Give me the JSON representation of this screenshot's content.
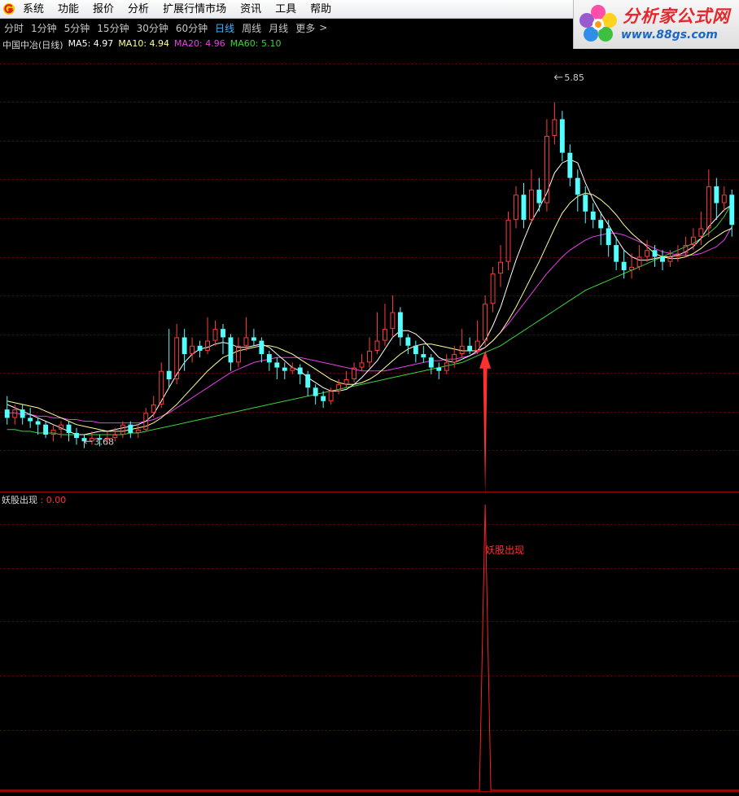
{
  "menu": {
    "items": [
      "系统",
      "功能",
      "报价",
      "分析",
      "扩展行情市场",
      "资讯",
      "工具",
      "帮助"
    ]
  },
  "brand": {
    "title": "分析家公式网",
    "url": "www.88gs.com"
  },
  "periods": {
    "tabs": [
      "分时",
      "1分钟",
      "5分钟",
      "15分钟",
      "30分钟",
      "60分钟",
      "日线",
      "周线",
      "月线",
      "更多"
    ],
    "active": "日线",
    "more_icon": "chevron-right-icon"
  },
  "legend": {
    "title": "中国中冶(日线)",
    "ma5": "MA5: 4.97",
    "ma10": "MA10: 4.94",
    "ma20": "MA20: 4.96",
    "ma60": "MA60: 5.10"
  },
  "indicator": {
    "name": "妖股出现",
    "value": ": 0.00",
    "signal_label": "妖股出现"
  },
  "colors": {
    "up": "#ff3c3c",
    "down": "#54ffff",
    "ma5": "#ffffff",
    "ma10": "#ffff9a",
    "ma20": "#e640e6",
    "ma60": "#3cd23c",
    "signal": "#ff2020",
    "background": "#000000"
  },
  "chart_data": {
    "type": "candlestick",
    "price_range": [
      3.4,
      6.0
    ],
    "high_label": "5.85",
    "low_label": "3.68",
    "high": 5.85,
    "low": 3.68,
    "candles": [
      [
        3.87,
        3.82,
        3.95,
        3.78
      ],
      [
        3.82,
        3.87,
        3.9,
        3.78
      ],
      [
        3.87,
        3.82,
        3.9,
        3.78
      ],
      [
        3.82,
        3.8,
        3.88,
        3.76
      ],
      [
        3.8,
        3.78,
        3.82,
        3.72
      ],
      [
        3.78,
        3.72,
        3.8,
        3.7
      ],
      [
        3.72,
        3.75,
        3.78,
        3.68
      ],
      [
        3.75,
        3.78,
        3.8,
        3.7
      ],
      [
        3.78,
        3.73,
        3.8,
        3.68
      ],
      [
        3.73,
        3.7,
        3.76,
        3.66
      ],
      [
        3.7,
        3.68,
        3.72,
        3.64
      ],
      [
        3.68,
        3.7,
        3.74,
        3.66
      ],
      [
        3.7,
        3.69,
        3.72,
        3.65
      ],
      [
        3.69,
        3.7,
        3.74,
        3.66
      ],
      [
        3.7,
        3.72,
        3.76,
        3.68
      ],
      [
        3.72,
        3.78,
        3.8,
        3.7
      ],
      [
        3.78,
        3.73,
        3.8,
        3.7
      ],
      [
        3.73,
        3.75,
        3.78,
        3.7
      ],
      [
        3.75,
        3.85,
        3.88,
        3.74
      ],
      [
        3.85,
        3.9,
        3.95,
        3.82
      ],
      [
        3.9,
        4.1,
        4.15,
        3.88
      ],
      [
        4.1,
        4.05,
        4.35,
        4.0
      ],
      [
        4.05,
        4.3,
        4.38,
        4.02
      ],
      [
        4.3,
        4.2,
        4.35,
        4.1
      ],
      [
        4.2,
        4.25,
        4.3,
        4.15
      ],
      [
        4.25,
        4.22,
        4.28,
        4.18
      ],
      [
        4.22,
        4.28,
        4.42,
        4.2
      ],
      [
        4.28,
        4.35,
        4.4,
        4.25
      ],
      [
        4.35,
        4.3,
        4.38,
        4.2
      ],
      [
        4.3,
        4.15,
        4.32,
        4.1
      ],
      [
        4.15,
        4.25,
        4.3,
        4.12
      ],
      [
        4.25,
        4.3,
        4.42,
        4.22
      ],
      [
        4.3,
        4.28,
        4.35,
        4.25
      ],
      [
        4.28,
        4.2,
        4.3,
        4.15
      ],
      [
        4.2,
        4.15,
        4.22,
        4.1
      ],
      [
        4.15,
        4.12,
        4.18,
        4.05
      ],
      [
        4.12,
        4.1,
        4.15,
        4.05
      ],
      [
        4.1,
        4.12,
        4.15,
        4.08
      ],
      [
        4.12,
        4.08,
        4.14,
        4.02
      ],
      [
        4.08,
        4.0,
        4.1,
        3.95
      ],
      [
        4.0,
        3.95,
        4.02,
        3.9
      ],
      [
        3.95,
        3.92,
        3.98,
        3.88
      ],
      [
        3.92,
        3.98,
        4.0,
        3.9
      ],
      [
        3.98,
        4.02,
        4.05,
        3.96
      ],
      [
        4.02,
        4.05,
        4.1,
        4.0
      ],
      [
        4.05,
        4.12,
        4.15,
        4.03
      ],
      [
        4.12,
        4.15,
        4.2,
        4.1
      ],
      [
        4.15,
        4.22,
        4.3,
        4.12
      ],
      [
        4.22,
        4.28,
        4.45,
        4.2
      ],
      [
        4.28,
        4.35,
        4.5,
        4.25
      ],
      [
        4.35,
        4.45,
        4.55,
        4.3
      ],
      [
        4.45,
        4.3,
        4.48,
        4.25
      ],
      [
        4.3,
        4.25,
        4.32,
        4.2
      ],
      [
        4.25,
        4.2,
        4.28,
        4.15
      ],
      [
        4.2,
        4.18,
        4.25,
        4.15
      ],
      [
        4.18,
        4.12,
        4.2,
        4.08
      ],
      [
        4.12,
        4.1,
        4.15,
        4.05
      ],
      [
        4.1,
        4.15,
        4.2,
        4.08
      ],
      [
        4.15,
        4.2,
        4.25,
        4.12
      ],
      [
        4.2,
        4.25,
        4.35,
        4.18
      ],
      [
        4.25,
        4.22,
        4.3,
        4.2
      ],
      [
        4.22,
        4.28,
        4.4,
        4.2
      ],
      [
        4.28,
        4.5,
        4.55,
        4.25
      ],
      [
        4.5,
        4.68,
        4.72,
        4.45
      ],
      [
        4.68,
        4.75,
        4.85,
        4.6
      ],
      [
        4.75,
        5.0,
        5.05,
        4.7
      ],
      [
        5.0,
        5.15,
        5.2,
        4.95
      ],
      [
        5.15,
        5.0,
        5.22,
        4.95
      ],
      [
        5.0,
        5.18,
        5.3,
        4.98
      ],
      [
        5.18,
        5.1,
        5.25,
        5.05
      ],
      [
        5.1,
        5.5,
        5.6,
        5.05
      ],
      [
        5.5,
        5.6,
        5.7,
        5.45
      ],
      [
        5.6,
        5.4,
        5.65,
        5.35
      ],
      [
        5.4,
        5.25,
        5.45,
        5.2
      ],
      [
        5.25,
        5.15,
        5.3,
        5.05
      ],
      [
        5.15,
        5.05,
        5.2,
        4.98
      ],
      [
        5.05,
        5.0,
        5.1,
        4.95
      ],
      [
        5.0,
        4.95,
        5.05,
        4.85
      ],
      [
        4.95,
        4.85,
        5.0,
        4.78
      ],
      [
        4.85,
        4.75,
        4.9,
        4.7
      ],
      [
        4.75,
        4.7,
        4.82,
        4.65
      ],
      [
        4.7,
        4.72,
        4.8,
        4.65
      ],
      [
        4.72,
        4.78,
        4.85,
        4.7
      ],
      [
        4.78,
        4.82,
        4.88,
        4.75
      ],
      [
        4.82,
        4.78,
        4.85,
        4.72
      ],
      [
        4.78,
        4.75,
        4.82,
        4.7
      ],
      [
        4.75,
        4.78,
        4.82,
        4.72
      ],
      [
        4.78,
        4.8,
        4.85,
        4.75
      ],
      [
        4.8,
        4.85,
        4.9,
        4.78
      ],
      [
        4.85,
        4.9,
        4.95,
        4.82
      ],
      [
        4.9,
        4.95,
        5.05,
        4.85
      ],
      [
        4.95,
        5.2,
        5.3,
        4.9
      ],
      [
        5.2,
        5.1,
        5.25,
        5.0
      ],
      [
        5.1,
        5.15,
        5.2,
        5.05
      ],
      [
        5.15,
        4.97,
        5.18,
        4.9
      ]
    ],
    "ma5": [
      3.9,
      3.88,
      3.86,
      3.84,
      3.82,
      3.8,
      3.78,
      3.76,
      3.74,
      3.72,
      3.72,
      3.73,
      3.74,
      3.74,
      3.75,
      3.76,
      3.77,
      3.78,
      3.8,
      3.84,
      3.92,
      4.0,
      4.08,
      4.15,
      4.2,
      4.23,
      4.24,
      4.26,
      4.27,
      4.26,
      4.24,
      4.24,
      4.25,
      4.26,
      4.24,
      4.2,
      4.16,
      4.12,
      4.1,
      4.06,
      4.03,
      4.0,
      3.98,
      3.98,
      3.99,
      4.02,
      4.06,
      4.11,
      4.16,
      4.23,
      4.3,
      4.34,
      4.34,
      4.32,
      4.28,
      4.23,
      4.18,
      4.16,
      4.15,
      4.17,
      4.19,
      4.22,
      4.28,
      4.37,
      4.48,
      4.62,
      4.76,
      4.88,
      4.99,
      5.07,
      5.16,
      5.28,
      5.34,
      5.36,
      5.34,
      5.22,
      5.12,
      5.04,
      4.97,
      4.89,
      4.82,
      4.78,
      4.76,
      4.76,
      4.77,
      4.78,
      4.78,
      4.79,
      4.81,
      4.84,
      4.89,
      4.96,
      5.01,
      5.06,
      5.09
    ],
    "ma10": [
      3.92,
      3.91,
      3.9,
      3.89,
      3.88,
      3.86,
      3.84,
      3.82,
      3.8,
      3.78,
      3.77,
      3.76,
      3.75,
      3.74,
      3.74,
      3.74,
      3.75,
      3.76,
      3.77,
      3.79,
      3.82,
      3.86,
      3.9,
      3.95,
      4.0,
      4.05,
      4.1,
      4.14,
      4.18,
      4.2,
      4.22,
      4.23,
      4.24,
      4.25,
      4.25,
      4.24,
      4.22,
      4.2,
      4.17,
      4.14,
      4.11,
      4.08,
      4.05,
      4.03,
      4.02,
      4.02,
      4.03,
      4.05,
      4.08,
      4.12,
      4.16,
      4.2,
      4.23,
      4.25,
      4.26,
      4.26,
      4.25,
      4.24,
      4.23,
      4.22,
      4.22,
      4.22,
      4.24,
      4.28,
      4.33,
      4.4,
      4.48,
      4.57,
      4.66,
      4.75,
      4.85,
      4.95,
      5.04,
      5.1,
      5.14,
      5.16,
      5.15,
      5.12,
      5.08,
      5.03,
      4.97,
      4.92,
      4.88,
      4.84,
      4.8,
      4.78,
      4.77,
      4.77,
      4.78,
      4.8,
      4.83,
      4.87,
      4.9,
      4.93,
      4.95
    ],
    "ma20": [
      3.85,
      3.85,
      3.84,
      3.84,
      3.83,
      3.83,
      3.82,
      3.82,
      3.81,
      3.81,
      3.8,
      3.8,
      3.79,
      3.79,
      3.79,
      3.79,
      3.79,
      3.79,
      3.8,
      3.81,
      3.83,
      3.85,
      3.88,
      3.91,
      3.94,
      3.97,
      4.0,
      4.03,
      4.06,
      4.09,
      4.11,
      4.13,
      4.15,
      4.16,
      4.17,
      4.18,
      4.18,
      4.18,
      4.18,
      4.17,
      4.16,
      4.15,
      4.14,
      4.13,
      4.12,
      4.11,
      4.1,
      4.1,
      4.1,
      4.1,
      4.11,
      4.12,
      4.13,
      4.14,
      4.15,
      4.16,
      4.16,
      4.17,
      4.17,
      4.18,
      4.19,
      4.21,
      4.24,
      4.28,
      4.33,
      4.38,
      4.44,
      4.5,
      4.56,
      4.62,
      4.68,
      4.73,
      4.78,
      4.82,
      4.85,
      4.88,
      4.9,
      4.91,
      4.92,
      4.92,
      4.91,
      4.89,
      4.87,
      4.85,
      4.83,
      4.81,
      4.8,
      4.79,
      4.79,
      4.79,
      4.8,
      4.82,
      4.84,
      4.88,
      4.96
    ],
    "ma60": [
      3.75,
      3.75,
      3.74,
      3.74,
      3.73,
      3.73,
      3.73,
      3.72,
      3.72,
      3.72,
      3.72,
      3.72,
      3.72,
      3.72,
      3.72,
      3.72,
      3.73,
      3.73,
      3.74,
      3.75,
      3.76,
      3.77,
      3.78,
      3.79,
      3.8,
      3.81,
      3.82,
      3.83,
      3.84,
      3.85,
      3.86,
      3.87,
      3.88,
      3.89,
      3.9,
      3.91,
      3.92,
      3.93,
      3.94,
      3.95,
      3.96,
      3.97,
      3.98,
      3.99,
      4.0,
      4.01,
      4.02,
      4.03,
      4.04,
      4.05,
      4.06,
      4.07,
      4.08,
      4.09,
      4.1,
      4.11,
      4.12,
      4.13,
      4.14,
      4.15,
      4.17,
      4.19,
      4.21,
      4.23,
      4.25,
      4.28,
      4.31,
      4.34,
      4.37,
      4.4,
      4.43,
      4.46,
      4.49,
      4.52,
      4.55,
      4.58,
      4.6,
      4.62,
      4.64,
      4.66,
      4.68,
      4.7,
      4.72,
      4.74,
      4.76,
      4.78,
      4.8,
      4.82,
      4.84,
      4.86,
      4.89,
      4.92,
      4.96,
      5.02,
      5.1
    ],
    "signal": {
      "index": 62,
      "value": 1,
      "range": [
        0,
        1
      ]
    }
  }
}
